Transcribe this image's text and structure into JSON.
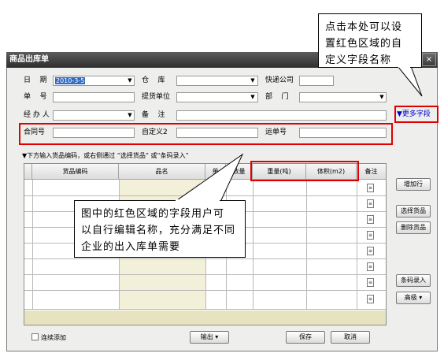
{
  "window": {
    "title": "商品出库单",
    "close_label": "×"
  },
  "form": {
    "date_label": "日    期",
    "date_value": "2010-3-5",
    "warehouse_label": "仓    库",
    "warehouse_value": "",
    "courier_label": "快递公司",
    "courier_value": "",
    "order_no_label": "单    号",
    "order_no_value": "",
    "pickup_unit_label": "提货单位",
    "pickup_unit_value": "",
    "department_label": "部    门",
    "department_value": "",
    "handler_label": "经 办 人",
    "handler_value": "",
    "remark_label": "备    注",
    "remark_value": "",
    "contract_label": "合同号",
    "contract_value": "",
    "custom2_label": "自定义2",
    "custom2_value": "",
    "waybill_label": "运单号",
    "waybill_value": ""
  },
  "more_fields_label": "▼更多字段",
  "hint_text": "▼下方输入货品编码，或右侧通过 “选择货品” 或“条码录入”",
  "table": {
    "headers": [
      "",
      "货品编码",
      "品名",
      "单",
      "数量",
      "重量(吨)",
      "体积(m2)",
      "备注"
    ],
    "row_count": 8
  },
  "side_buttons": {
    "add_row": "增加行",
    "select_goods": "选择货品",
    "delete_goods": "删除货品",
    "barcode_entry": "条码录入",
    "advanced": "高级 ▾"
  },
  "bottom": {
    "continuous_add": "连续添加",
    "export": "输出 ▾",
    "save": "保存",
    "cancel": "取消"
  },
  "callouts": {
    "top_right": "点击本处可以设\n置红色区域的自\n定义字段名称",
    "middle": "图中的红色区域的字段用户可\n以自行编辑名称，充分满足不同\n企业的出入库单需要"
  },
  "colors": {
    "highlight": "#e00000",
    "link": "#0000cc",
    "titlebar": "#3a3a3a"
  }
}
